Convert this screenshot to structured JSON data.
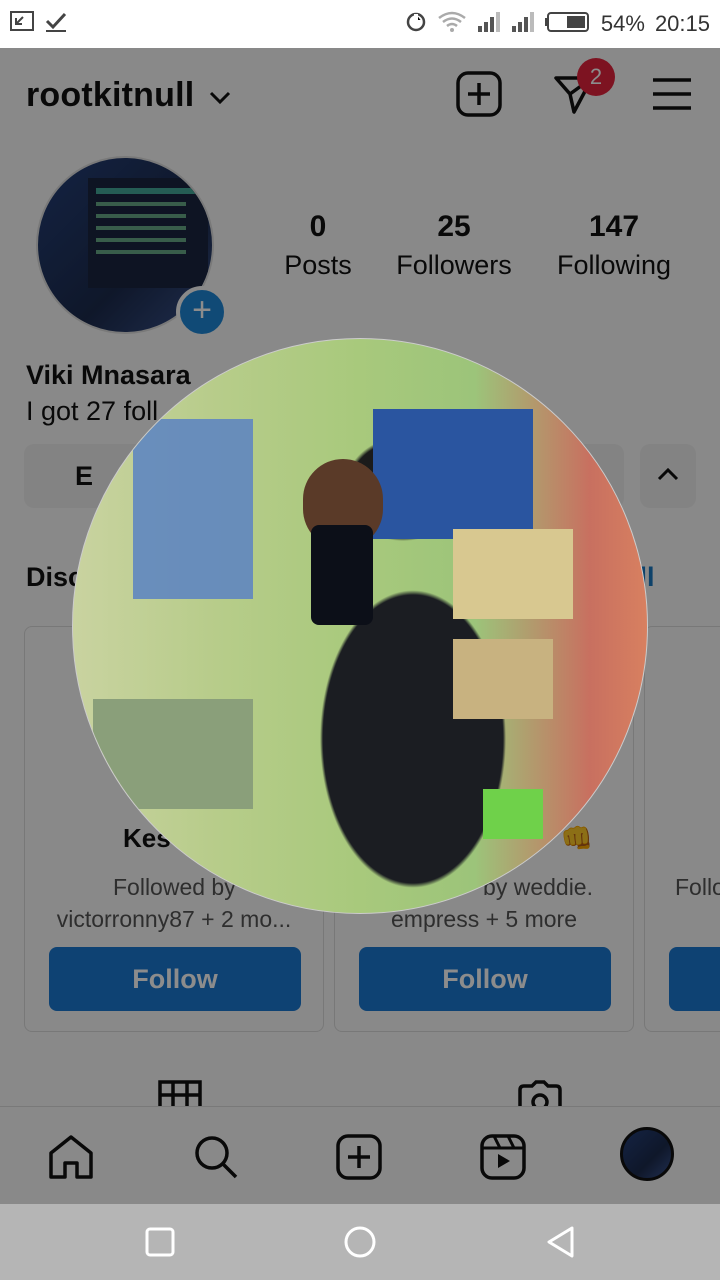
{
  "status_bar": {
    "battery": "54%",
    "time": "20:15"
  },
  "header": {
    "username": "rootkitnull",
    "messages_badge": "2"
  },
  "profile": {
    "stats": [
      {
        "value": "0",
        "label": "Posts"
      },
      {
        "value": "25",
        "label": "Followers"
      },
      {
        "value": "147",
        "label": "Following"
      }
    ],
    "name": "Viki Mnasara",
    "bio_visible": "I got 27 foll",
    "edit_button_visible": "E"
  },
  "discover": {
    "title_visible": "Disc",
    "see_all_visible": "e all",
    "cards": [
      {
        "name_visible": "Kes",
        "sub_line1_visible": "Followed by",
        "sub_line2_visible": "victorronny87 + 2 mo...",
        "button": "Follow"
      },
      {
        "name_visible": "👊",
        "sub_line1_visible": "by weddie.",
        "sub_line2_visible": "empress + 5 more",
        "button": "Follow"
      },
      {
        "name_visible": "",
        "sub_line1_visible": "Follo",
        "sub_line2_visible": "",
        "button": ""
      }
    ]
  },
  "colors": {
    "follow_button": "#1a78d2",
    "badge": "#e4233d",
    "overlay": "rgba(0,0,0,0.45)"
  }
}
